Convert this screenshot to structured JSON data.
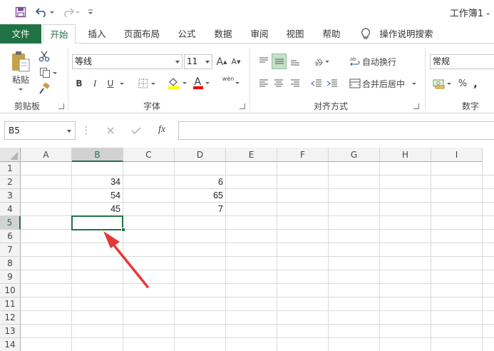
{
  "window": {
    "title": "工作簿1 -"
  },
  "tabs": [
    {
      "id": "file",
      "label": "文件"
    },
    {
      "id": "home",
      "label": "开始"
    },
    {
      "id": "insert",
      "label": "插入"
    },
    {
      "id": "pagelayout",
      "label": "页面布局"
    },
    {
      "id": "formulas",
      "label": "公式"
    },
    {
      "id": "data",
      "label": "数据"
    },
    {
      "id": "review",
      "label": "审阅"
    },
    {
      "id": "view",
      "label": "视图"
    },
    {
      "id": "help",
      "label": "帮助"
    }
  ],
  "tellme": "操作说明搜索",
  "ribbon": {
    "clipboard": {
      "paste": "粘贴",
      "group": "剪贴板"
    },
    "font": {
      "name": "等线",
      "size": "11",
      "group": "字体",
      "bold": "B",
      "italic": "I",
      "underline": "U",
      "font_color": "A",
      "grow": "A",
      "shrink": "A",
      "phonetic": "wén"
    },
    "alignment": {
      "wrap": "自动换行",
      "merge": "合并后居中",
      "group": "对齐方式"
    },
    "number": {
      "format": "常规",
      "percent": "%",
      "comma": ",",
      "group": "数字"
    }
  },
  "formula_bar": {
    "name_box": "B5",
    "fx": "fx",
    "value": ""
  },
  "columns": [
    "A",
    "B",
    "C",
    "D",
    "E",
    "F",
    "G",
    "H",
    "I"
  ],
  "rows": [
    "1",
    "2",
    "3",
    "4",
    "5",
    "6",
    "7",
    "8",
    "9",
    "10",
    "11",
    "12",
    "13",
    "14"
  ],
  "selected": {
    "col": "B",
    "row": "5"
  },
  "cells": {
    "B2": "34",
    "D2": "6",
    "B3": "54",
    "D3": "65",
    "B4": "45",
    "D4": "7"
  },
  "colors": {
    "accent": "#217346",
    "annotation": "#e53935"
  }
}
